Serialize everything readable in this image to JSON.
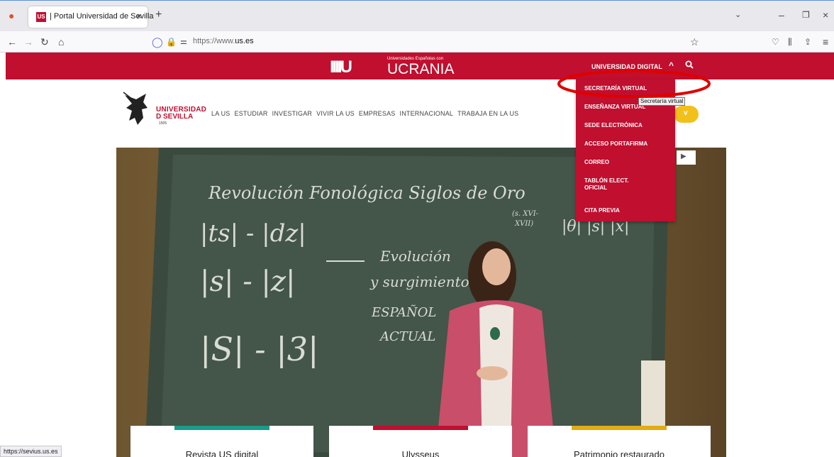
{
  "browser": {
    "tab_title": "| Portal Universidad de Sevilla",
    "tab_close": "×",
    "new_tab": "+",
    "tab_favicon_text": "US",
    "url_prefix": "https://www.",
    "url_domain": "us.es",
    "status_url": "https://sevius.us.es"
  },
  "topbar": {
    "logo_mark": "IIIIU",
    "logo_sub": "Universidades Españolas con",
    "logo_main": "UCRANIA",
    "digital_label": "UNIVERSIDAD DIGITAL",
    "chevron": "^"
  },
  "header": {
    "logo_line1": "UNIVERSIDAD",
    "logo_line2": "D SEVILLA",
    "logo_year": "1505",
    "nav": [
      "LA US",
      "ESTUDIAR",
      "INVESTIGAR",
      "VIVIR LA US",
      "EMPRESAS",
      "INTERNACIONAL",
      "TRABAJA EN LA US"
    ],
    "yellow_chevron": "v"
  },
  "dropdown": {
    "items": [
      "SECRETARÍA VIRTUAL",
      "ENSEÑANZA VIRTUAL",
      "SEDE ELECTRÓNICA",
      "ACCESO PORTAFIRMA",
      "CORREO",
      "TABLÓN ELECT.",
      "OFICIAL",
      "CITA PREVIA"
    ],
    "tooltip": "Secretaría virtual"
  },
  "hero": {
    "chalk_lines": [
      "Revolución Fonológica Siglos de Oro",
      "|ts| - |dz|",
      "|s| - |z|",
      "|S| - |3|",
      "Evolución",
      "y surgimiento",
      "ESPAÑOL",
      "ACTUAL",
      "(s. XVI-",
      "XVII)",
      "|θ| |s| |x|"
    ]
  },
  "cards": [
    {
      "title": "Revista US digital",
      "color": "#1a9c8a"
    },
    {
      "title": "Ulysseus",
      "color": "#c00f2f"
    },
    {
      "title": "Patrimonio restaurado",
      "color": "#e2ac14"
    }
  ],
  "colors": {
    "brand_red": "#c00f2f",
    "accent_yellow": "#f2c01b",
    "annotation_red": "#e00000"
  }
}
